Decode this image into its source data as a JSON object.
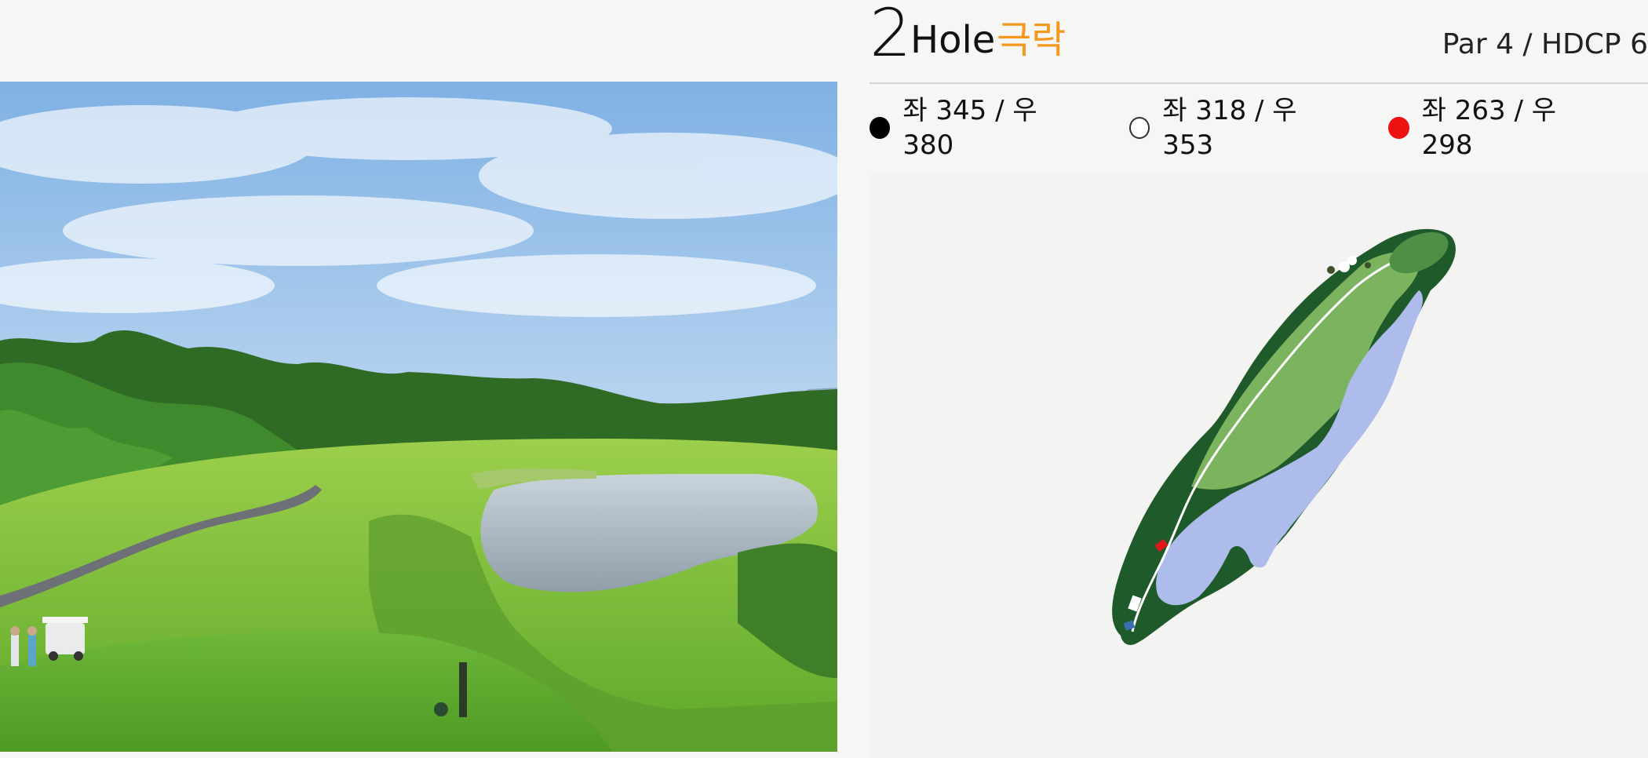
{
  "hole": {
    "number": "2",
    "label": "Hole",
    "name": "극락",
    "par_info": "Par 4 / HDCP 6"
  },
  "tees": [
    {
      "color": "#000000",
      "marker": "black-tee-dot",
      "text": "좌 345 / 우 380"
    },
    {
      "color": "#ffffff",
      "marker": "white-tee-dot",
      "text": "좌 318 / 우 353"
    },
    {
      "color": "#ee1111",
      "marker": "red-tee-dot",
      "text": "좌 263 / 우 298"
    }
  ],
  "colors": {
    "accent": "#f39a1e",
    "rough": "#1f5a2a",
    "fairway": "#7cb35e",
    "water": "#aebcec",
    "sky": "#9cc2e8",
    "grass": "#7fbf3a"
  }
}
